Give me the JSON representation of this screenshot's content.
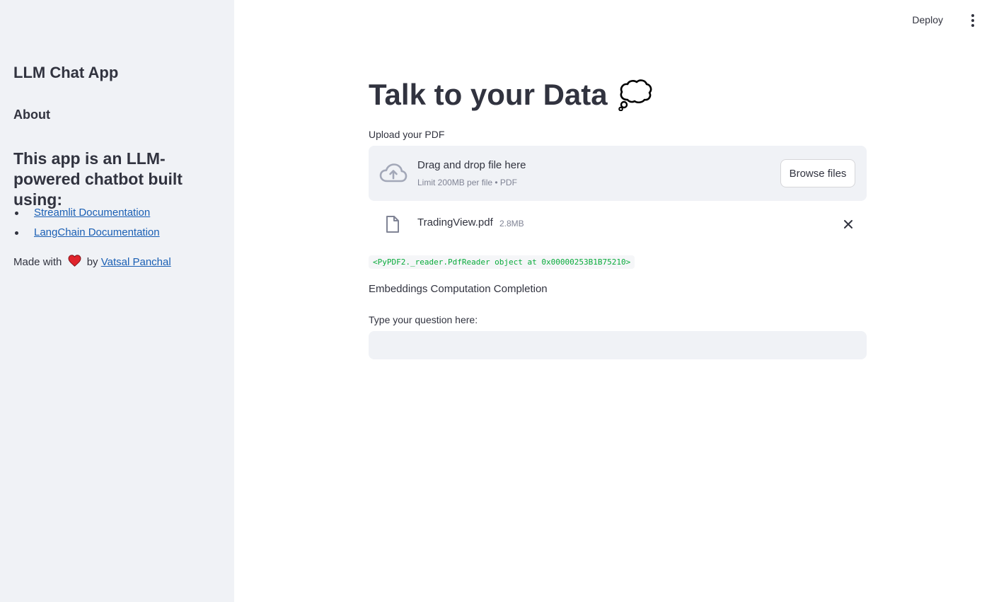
{
  "sidebar": {
    "title": "LLM Chat App",
    "about_heading": "About",
    "description": "This app is an LLM-powered chatbot built using:",
    "links": [
      {
        "label": "Streamlit Documentation"
      },
      {
        "label": "LangChain Documentation"
      }
    ],
    "made_with_prefix": "Made with",
    "made_with_by": "by",
    "author_link": "Vatsal Panchal"
  },
  "topbar": {
    "deploy_label": "Deploy",
    "menu_icon": "more-vertical-icon"
  },
  "main": {
    "title": "Talk to your Data",
    "title_icon": "thought-bubble-icon",
    "upload_label": "Upload your PDF",
    "uploader": {
      "drop_title": "Drag and drop file here",
      "drop_hint": "Limit 200MB per file • PDF",
      "browse_label": "Browse files",
      "icon": "cloud-upload-icon"
    },
    "uploaded_file": {
      "name": "TradingView.pdf",
      "size": "2.8MB",
      "icon": "file-icon",
      "remove_icon": "close-icon"
    },
    "code_output": "<PyPDF2._reader.PdfReader object at 0x00000253B1B75210>",
    "status_text": "Embeddings Computation Completion",
    "question_label": "Type your question here:",
    "question_value": ""
  },
  "colors": {
    "sidebar_bg": "#f0f2f6",
    "text": "#31333f",
    "link": "#1a5fb4",
    "code_green": "#09ab3b",
    "heart_red": "#e0242c"
  }
}
